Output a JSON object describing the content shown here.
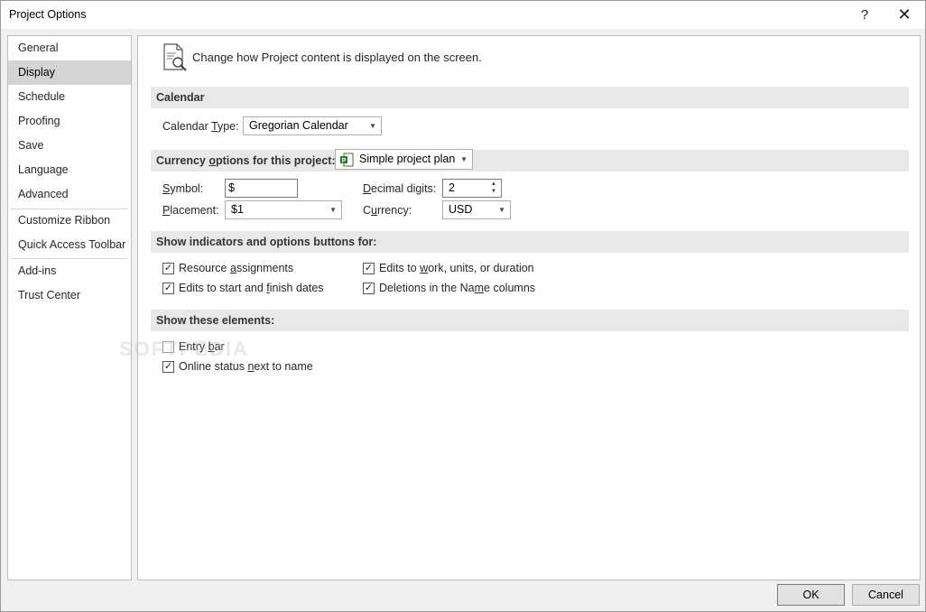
{
  "window": {
    "title": "Project Options",
    "help": "?",
    "close": "✕"
  },
  "nav": {
    "items": [
      {
        "label": "General"
      },
      {
        "label": "Display"
      },
      {
        "label": "Schedule"
      },
      {
        "label": "Proofing"
      },
      {
        "label": "Save"
      },
      {
        "label": "Language"
      },
      {
        "label": "Advanced"
      },
      {
        "label": "Customize Ribbon"
      },
      {
        "label": "Quick Access Toolbar"
      },
      {
        "label": "Add-ins"
      },
      {
        "label": "Trust Center"
      }
    ],
    "selected": "Display"
  },
  "intro": {
    "text": "Change how Project content is displayed on the screen.",
    "icon": "document-magnifier-icon"
  },
  "calendar": {
    "header": "Calendar",
    "type_label_a": "Calendar ",
    "type_label_u": "T",
    "type_label_b": "ype:",
    "type_value": "Gregorian Calendar"
  },
  "currency": {
    "header_a": "Currency ",
    "header_u": "o",
    "header_b": "ptions for this project:",
    "project_value": "Simple project plan",
    "symbol_label_u": "S",
    "symbol_label_b": "ymbol:",
    "symbol_value": "$",
    "placement_label_u": "P",
    "placement_label_b": "lacement:",
    "placement_value": "$1",
    "decimal_label_u": "D",
    "decimal_label_b": "ecimal digits:",
    "decimal_value": "2",
    "currency_label_a": "C",
    "currency_label_u": "u",
    "currency_label_b": "rrency:",
    "currency_value": "USD"
  },
  "indicators": {
    "header": "Show indicators and options buttons for:",
    "items": [
      {
        "a": "Resource ",
        "u": "a",
        "b": "ssignments",
        "checked": true
      },
      {
        "a": "Edits to start and ",
        "u": "f",
        "b": "inish dates",
        "checked": true
      },
      {
        "a": "Edits to ",
        "u": "w",
        "b": "ork, units, or duration",
        "checked": true
      },
      {
        "a": "Deletions in the Na",
        "u": "m",
        "b": "e columns",
        "checked": true
      }
    ]
  },
  "elements": {
    "header": "Show these elements:",
    "items": [
      {
        "a": "Entry ",
        "u": "b",
        "b": "ar",
        "checked": false
      },
      {
        "a": "Online status ",
        "u": "n",
        "b": "ext to name",
        "checked": true
      }
    ]
  },
  "watermark": "SOFTPEDIA",
  "buttons": {
    "ok": "OK",
    "cancel": "Cancel"
  }
}
